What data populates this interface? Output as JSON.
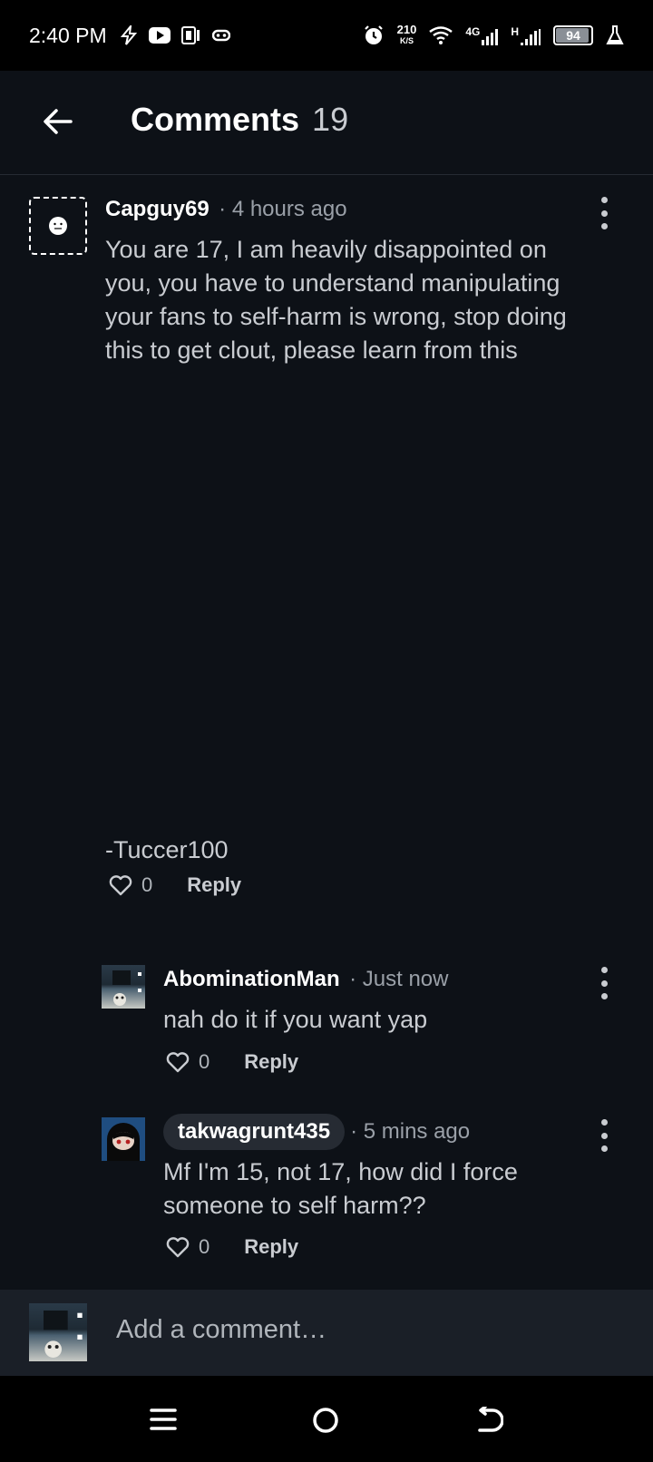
{
  "status_bar": {
    "time": "2:40 PM",
    "net_speed_value": "210",
    "net_speed_unit": "K/S",
    "net_type": "4G",
    "signal2_label": "H",
    "battery": "94",
    "battery_level": 0.94
  },
  "header": {
    "title": "Comments",
    "count": "19"
  },
  "comments": [
    {
      "author": "Capguy69",
      "meta": "· 4 hours ago",
      "body": "You are 17, I am heavily disappointed on you, you have to understand manipulating your fans to self-harm is wrong, stop doing this to get clout, please learn from this",
      "signature": "-Tuccer100",
      "likes": "0",
      "reply_label": "Reply"
    },
    {
      "author": "AbominationMan",
      "meta": "· Just now",
      "body": "nah do it if you want yap",
      "likes": "0",
      "reply_label": "Reply"
    },
    {
      "author": "takwagrunt435",
      "meta": "· 5 mins ago",
      "body": "Mf I'm 15, not 17, how did I force someone to self harm??",
      "likes": "0",
      "reply_label": "Reply"
    }
  ],
  "compose": {
    "placeholder": "Add a comment…"
  },
  "icons": {
    "back": "arrow-left-icon",
    "more": "kebab-menu-icon",
    "like": "heart-outline-icon",
    "nav_recents": "menu-icon",
    "nav_home": "circle-home-icon",
    "nav_back": "return-arrow-icon"
  }
}
